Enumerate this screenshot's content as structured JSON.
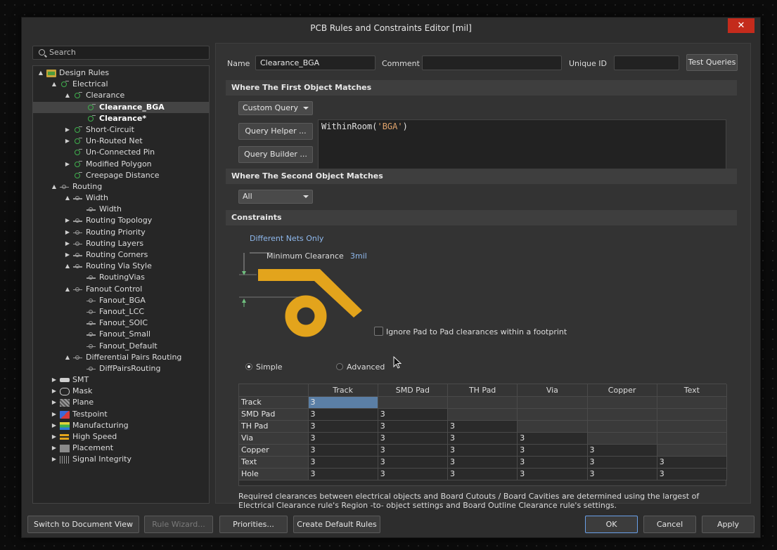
{
  "window": {
    "title": "PCB Rules and Constraints Editor [mil]",
    "close_glyph": "✕"
  },
  "search": {
    "placeholder": "Search"
  },
  "tree": [
    {
      "label": "Design Rules",
      "level": 0,
      "arrow": "▲",
      "icon": "folder-icon"
    },
    {
      "label": "Electrical",
      "level": 1,
      "arrow": "▲",
      "icon": "electrical-rule-icon"
    },
    {
      "label": "Clearance",
      "level": 2,
      "arrow": "▲",
      "icon": "electrical-rule-icon"
    },
    {
      "label": "Clearance_BGA",
      "level": 3,
      "arrow": "",
      "icon": "electrical-rule-icon",
      "selected": true
    },
    {
      "label": "Clearance*",
      "level": 3,
      "arrow": "",
      "icon": "electrical-rule-icon",
      "bold": true
    },
    {
      "label": "Short-Circuit",
      "level": 2,
      "arrow": "▶",
      "icon": "electrical-rule-icon"
    },
    {
      "label": "Un-Routed Net",
      "level": 2,
      "arrow": "▶",
      "icon": "electrical-rule-icon"
    },
    {
      "label": "Un-Connected Pin",
      "level": 2,
      "arrow": "",
      "icon": "electrical-rule-icon"
    },
    {
      "label": "Modified Polygon",
      "level": 2,
      "arrow": "▶",
      "icon": "electrical-rule-icon"
    },
    {
      "label": "Creepage Distance",
      "level": 2,
      "arrow": "",
      "icon": "electrical-rule-icon"
    },
    {
      "label": "Routing",
      "level": 1,
      "arrow": "▲",
      "icon": "routing-rule-icon"
    },
    {
      "label": "Width",
      "level": 2,
      "arrow": "▲",
      "icon": "routing-rule-icon"
    },
    {
      "label": "Width",
      "level": 3,
      "arrow": "",
      "icon": "routing-rule-icon"
    },
    {
      "label": "Routing Topology",
      "level": 2,
      "arrow": "▶",
      "icon": "routing-rule-icon"
    },
    {
      "label": "Routing Priority",
      "level": 2,
      "arrow": "▶",
      "icon": "routing-rule-icon"
    },
    {
      "label": "Routing Layers",
      "level": 2,
      "arrow": "▶",
      "icon": "routing-rule-icon"
    },
    {
      "label": "Routing Corners",
      "level": 2,
      "arrow": "▶",
      "icon": "routing-rule-icon"
    },
    {
      "label": "Routing Via Style",
      "level": 2,
      "arrow": "▲",
      "icon": "routing-rule-icon"
    },
    {
      "label": "RoutingVias",
      "level": 3,
      "arrow": "",
      "icon": "routing-rule-icon"
    },
    {
      "label": "Fanout Control",
      "level": 2,
      "arrow": "▲",
      "icon": "routing-rule-icon"
    },
    {
      "label": "Fanout_BGA",
      "level": 3,
      "arrow": "",
      "icon": "routing-rule-icon"
    },
    {
      "label": "Fanout_LCC",
      "level": 3,
      "arrow": "",
      "icon": "routing-rule-icon"
    },
    {
      "label": "Fanout_SOIC",
      "level": 3,
      "arrow": "",
      "icon": "routing-rule-icon"
    },
    {
      "label": "Fanout_Small",
      "level": 3,
      "arrow": "",
      "icon": "routing-rule-icon"
    },
    {
      "label": "Fanout_Default",
      "level": 3,
      "arrow": "",
      "icon": "routing-rule-icon"
    },
    {
      "label": "Differential Pairs Routing",
      "level": 2,
      "arrow": "▲",
      "icon": "routing-rule-icon"
    },
    {
      "label": "DiffPairsRouting",
      "level": 3,
      "arrow": "",
      "icon": "routing-rule-icon"
    },
    {
      "label": "SMT",
      "level": 1,
      "arrow": "▶",
      "icon": "smt-icon"
    },
    {
      "label": "Mask",
      "level": 1,
      "arrow": "▶",
      "icon": "mask-icon"
    },
    {
      "label": "Plane",
      "level": 1,
      "arrow": "▶",
      "icon": "plane-icon"
    },
    {
      "label": "Testpoint",
      "level": 1,
      "arrow": "▶",
      "icon": "testpoint-icon"
    },
    {
      "label": "Manufacturing",
      "level": 1,
      "arrow": "▶",
      "icon": "manufacturing-icon"
    },
    {
      "label": "High Speed",
      "level": 1,
      "arrow": "▶",
      "icon": "high-speed-icon"
    },
    {
      "label": "Placement",
      "level": 1,
      "arrow": "▶",
      "icon": "placement-icon"
    },
    {
      "label": "Signal Integrity",
      "level": 1,
      "arrow": "▶",
      "icon": "signal-integrity-icon"
    }
  ],
  "rule": {
    "name_label": "Name",
    "name_value": "Clearance_BGA",
    "comment_label": "Comment",
    "comment_value": "",
    "uid_label": "Unique ID",
    "uid_value": "",
    "test_queries": "Test Queries"
  },
  "first_match": {
    "header": "Where The First Object Matches",
    "combo": "Custom Query",
    "query_helper": "Query Helper ...",
    "query_builder": "Query Builder ...",
    "query_fn": "WithinRoom(",
    "query_arg": "'BGA'",
    "query_close": ")"
  },
  "second_match": {
    "header": "Where The Second Object Matches",
    "combo": "All"
  },
  "constraints": {
    "header": "Constraints",
    "net_scope": "Different Nets Only",
    "min_clearance_label": "Minimum Clearance",
    "min_clearance_value": "3mil",
    "ignore_pad_label": "Ignore Pad to Pad clearances within a footprint",
    "simple_label": "Simple",
    "advanced_label": "Advanced",
    "accent_color": "#e3a41c"
  },
  "matrix": {
    "columns": [
      "Track",
      "SMD Pad",
      "TH Pad",
      "Via",
      "Copper",
      "Text"
    ],
    "rows": [
      {
        "name": "Track",
        "values": [
          "3",
          "",
          "",
          "",
          "",
          ""
        ]
      },
      {
        "name": "SMD Pad",
        "values": [
          "3",
          "3",
          "",
          "",
          "",
          ""
        ]
      },
      {
        "name": "TH Pad",
        "values": [
          "3",
          "3",
          "3",
          "",
          "",
          ""
        ]
      },
      {
        "name": "Via",
        "values": [
          "3",
          "3",
          "3",
          "3",
          "",
          ""
        ]
      },
      {
        "name": "Copper",
        "values": [
          "3",
          "3",
          "3",
          "3",
          "3",
          ""
        ]
      },
      {
        "name": "Text",
        "values": [
          "3",
          "3",
          "3",
          "3",
          "3",
          "3"
        ]
      },
      {
        "name": "Hole",
        "values": [
          "3",
          "3",
          "3",
          "3",
          "3",
          "3"
        ]
      }
    ]
  },
  "note": "Required clearances between electrical objects and Board Cutouts / Board Cavities are determined using the largest of Electrical Clearance rule's Region -to- object settings and Board Outline Clearance rule's settings.",
  "footer": {
    "switch_doc": "Switch to Document View",
    "rule_wizard": "Rule Wizard...",
    "priorities": "Priorities...",
    "create_default": "Create Default Rules",
    "ok": "OK",
    "cancel": "Cancel",
    "apply": "Apply"
  }
}
